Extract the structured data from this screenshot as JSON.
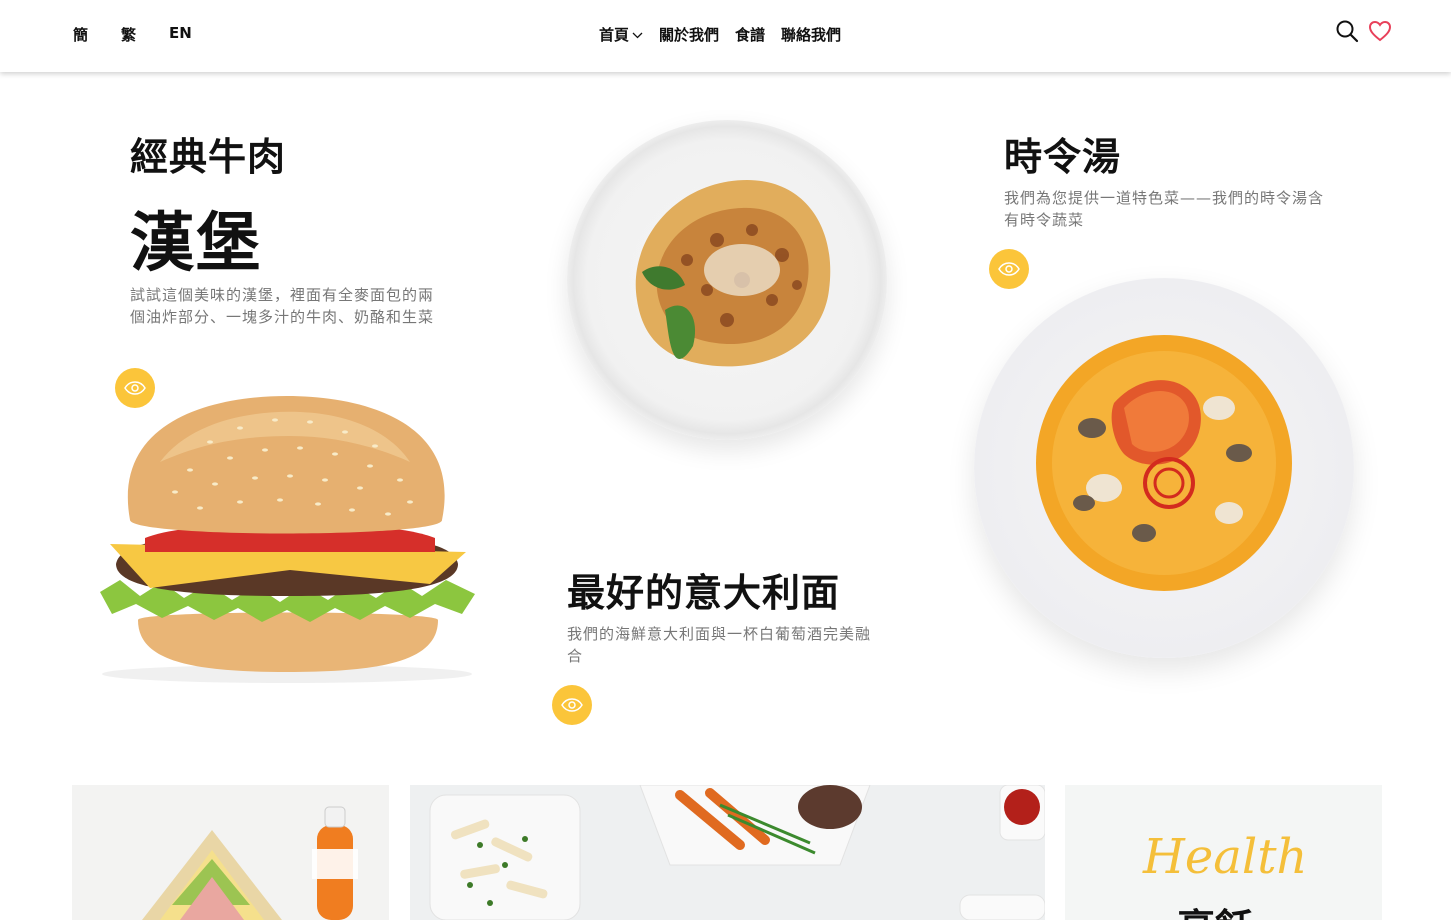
{
  "header": {
    "languages": [
      "簡",
      "繁",
      "EN"
    ],
    "nav": {
      "home": "首頁",
      "about": "關於我們",
      "recipes": "食譜",
      "contact": "聯絡我們"
    },
    "icons": [
      "search-icon",
      "heart-icon"
    ]
  },
  "hero": {
    "burger": {
      "title_small": "經典牛肉",
      "title_large": "漢堡",
      "description": "試試這個美味的漢堡，裡面有全麥面包的兩個油炸部分、一塊多汁的牛肉、奶酪和生菜"
    },
    "pasta": {
      "title": "最好的意大利面",
      "description": "我們的海鮮意大利面與一杯白葡萄酒完美融合"
    },
    "soup": {
      "title": "時令湯",
      "description": "我們為您提供一道特色菜——我們的時令湯含有時令蔬菜"
    }
  },
  "cards": {
    "health_title": "Health",
    "health_sub": "烹飪"
  },
  "colors": {
    "accent": "#fbc53a",
    "heart": "#e8405a"
  }
}
